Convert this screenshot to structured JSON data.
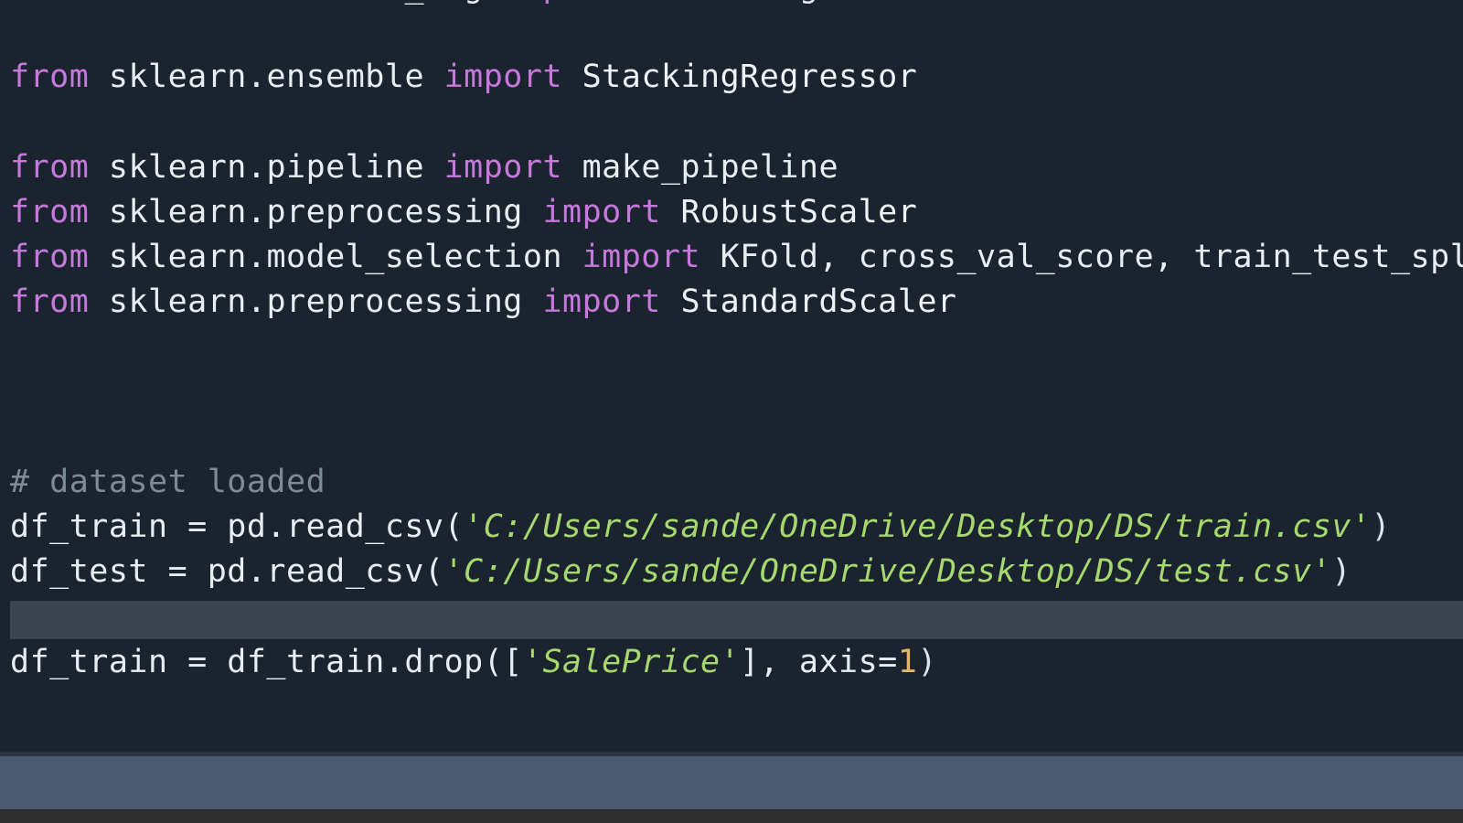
{
  "editor": {
    "background_color": "#1b232e",
    "foreground_color": "#d7dfe8",
    "keyword_color": "#c678dd",
    "string_color": "#a5d86e",
    "number_color": "#e5b567",
    "comment_color": "#7d8b99",
    "selection_color": "#3c4451",
    "lines": [
      {
        "id": "line-clipped-top",
        "clipped": true,
        "tokens": [
          {
            "text": "                    ",
            "kind": "id"
          },
          {
            "text": "_",
            "kind": "id"
          },
          {
            "text": "  ",
            "kind": "id"
          },
          {
            "text": "g",
            "kind": "id"
          },
          {
            "text": "   ",
            "kind": "id"
          },
          {
            "text": "p",
            "kind": "kw"
          },
          {
            "text": "            ",
            "kind": "id"
          },
          {
            "text": "g",
            "kind": "id"
          }
        ]
      },
      {
        "id": "line-blank-1",
        "tokens": [
          {
            "text": "",
            "kind": "id"
          }
        ]
      },
      {
        "id": "line-import-stacking-regressor",
        "tokens": [
          {
            "text": "from",
            "kind": "kw"
          },
          {
            "text": " sklearn.ensemble ",
            "kind": "id"
          },
          {
            "text": "import",
            "kind": "kw"
          },
          {
            "text": " StackingRegressor",
            "kind": "cls"
          }
        ]
      },
      {
        "id": "line-blank-2",
        "tokens": [
          {
            "text": "",
            "kind": "id"
          }
        ]
      },
      {
        "id": "line-import-make-pipeline",
        "tokens": [
          {
            "text": "from",
            "kind": "kw"
          },
          {
            "text": " sklearn.pipeline ",
            "kind": "id"
          },
          {
            "text": "import",
            "kind": "kw"
          },
          {
            "text": " make_pipeline",
            "kind": "id"
          }
        ]
      },
      {
        "id": "line-import-robust-scaler",
        "tokens": [
          {
            "text": "from",
            "kind": "kw"
          },
          {
            "text": " sklearn.preprocessing ",
            "kind": "id"
          },
          {
            "text": "import",
            "kind": "kw"
          },
          {
            "text": " RobustScaler",
            "kind": "cls"
          }
        ]
      },
      {
        "id": "line-import-model-selection",
        "tokens": [
          {
            "text": "from",
            "kind": "kw"
          },
          {
            "text": " sklearn.model_selection ",
            "kind": "id"
          },
          {
            "text": "import",
            "kind": "kw"
          },
          {
            "text": " KFold, cross_val_score, train_test_split",
            "kind": "id"
          }
        ]
      },
      {
        "id": "line-import-standard-scaler",
        "tokens": [
          {
            "text": "from",
            "kind": "kw"
          },
          {
            "text": " sklearn.preprocessing ",
            "kind": "id"
          },
          {
            "text": "import",
            "kind": "kw"
          },
          {
            "text": " StandardScaler",
            "kind": "cls"
          }
        ]
      },
      {
        "id": "line-blank-3",
        "tokens": [
          {
            "text": "",
            "kind": "id"
          }
        ]
      },
      {
        "id": "line-blank-4",
        "tokens": [
          {
            "text": "",
            "kind": "id"
          }
        ]
      },
      {
        "id": "line-blank-5",
        "tokens": [
          {
            "text": "",
            "kind": "id"
          }
        ]
      },
      {
        "id": "line-comment-dataset-loaded",
        "tokens": [
          {
            "text": "# dataset loaded",
            "kind": "cmt"
          }
        ]
      },
      {
        "id": "line-read-train-csv",
        "tokens": [
          {
            "text": "df_train = pd.read_csv(",
            "kind": "id"
          },
          {
            "text": "'C:/Users/sande/OneDrive/Desktop/DS/train.csv'",
            "kind": "str"
          },
          {
            "text": ")",
            "kind": "punct"
          }
        ]
      },
      {
        "id": "line-read-test-csv",
        "tokens": [
          {
            "text": "df_test = pd.read_csv(",
            "kind": "id"
          },
          {
            "text": "'C:/Users/sande/OneDrive/Desktop/DS/test.csv'",
            "kind": "str"
          },
          {
            "text": ")",
            "kind": "punct"
          }
        ]
      },
      {
        "id": "line-selected-blank",
        "selected": true,
        "tokens": [
          {
            "text": "",
            "kind": "id"
          }
        ]
      },
      {
        "id": "line-drop-saleprice",
        "tokens": [
          {
            "text": "df_train = df_train.drop([",
            "kind": "id"
          },
          {
            "text": "'SalePrice'",
            "kind": "str"
          },
          {
            "text": "], axis=",
            "kind": "id"
          },
          {
            "text": "1",
            "kind": "num"
          },
          {
            "text": ")",
            "kind": "punct"
          }
        ]
      },
      {
        "id": "line-blank-6",
        "tokens": [
          {
            "text": "",
            "kind": "id"
          }
        ]
      },
      {
        "id": "line-blank-7",
        "tokens": [
          {
            "text": "",
            "kind": "id"
          }
        ]
      }
    ]
  },
  "bottom_panel": {
    "background_color": "#4c5a70"
  },
  "bottom_bar": {
    "background_color": "#2f2f2f"
  }
}
